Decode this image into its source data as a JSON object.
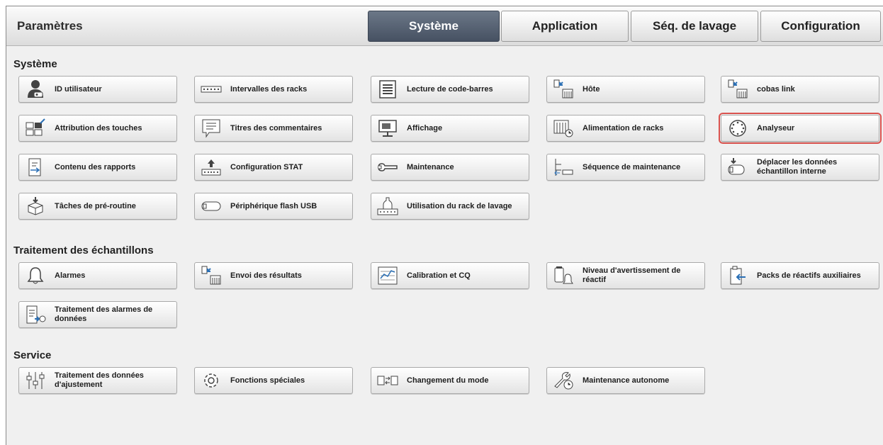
{
  "header": {
    "title": "Paramètres"
  },
  "tabs": [
    "Système",
    "Application",
    "Séq. de lavage",
    "Configuration"
  ],
  "sections": {
    "systeme": {
      "title": "Système",
      "buttons": [
        {
          "label": "ID utilisateur",
          "icon": "user-id-icon"
        },
        {
          "label": "Intervalles des racks",
          "icon": "rack-intervals-icon"
        },
        {
          "label": "Lecture de code-barres",
          "icon": "barcode-reading-icon"
        },
        {
          "label": "Hôte",
          "icon": "host-icon"
        },
        {
          "label": "cobas link",
          "icon": "cobas-link-icon"
        },
        {
          "label": "Attribution des touches",
          "icon": "key-assignment-icon"
        },
        {
          "label": "Titres des commentaires",
          "icon": "comment-titles-icon"
        },
        {
          "label": "Affichage",
          "icon": "display-icon"
        },
        {
          "label": "Alimentation de racks",
          "icon": "rack-feed-icon"
        },
        {
          "label": "Analyseur",
          "icon": "analyzer-icon"
        },
        {
          "label": "Contenu des rapports",
          "icon": "report-content-icon"
        },
        {
          "label": "Configuration STAT",
          "icon": "stat-configuration-icon"
        },
        {
          "label": "Maintenance",
          "icon": "maintenance-icon"
        },
        {
          "label": "Séquence de maintenance",
          "icon": "maintenance-sequence-icon"
        },
        {
          "label": "Déplacer les données échantillon interne",
          "icon": "move-sample-data-icon"
        },
        {
          "label": "Tâches de pré-routine",
          "icon": "pre-routine-tasks-icon"
        },
        {
          "label": "Périphérique flash USB",
          "icon": "usb-flash-icon"
        },
        {
          "label": "Utilisation du rack de lavage",
          "icon": "wash-rack-icon"
        }
      ]
    },
    "traitement": {
      "title": "Traitement des échantillons",
      "buttons": [
        {
          "label": "Alarmes",
          "icon": "bell-icon"
        },
        {
          "label": "Envoi des résultats",
          "icon": "send-results-icon"
        },
        {
          "label": "Calibration et CQ",
          "icon": "calibration-qc-icon"
        },
        {
          "label": "Niveau d'avertissement de réactif",
          "icon": "reagent-warning-icon"
        },
        {
          "label": "Packs de réactifs auxiliaires",
          "icon": "auxiliary-reagent-icon"
        },
        {
          "label": "Traitement des alarmes de données",
          "icon": "data-alarm-icon"
        }
      ]
    },
    "service": {
      "title": "Service",
      "buttons": [
        {
          "label": "Traitement des données d'ajustement",
          "icon": "adjustment-data-icon"
        },
        {
          "label": "Fonctions spéciales",
          "icon": "gear-icon"
        },
        {
          "label": "Changement du mode",
          "icon": "mode-change-icon"
        },
        {
          "label": "Maintenance autonome",
          "icon": "wrench-clock-icon"
        }
      ]
    }
  }
}
